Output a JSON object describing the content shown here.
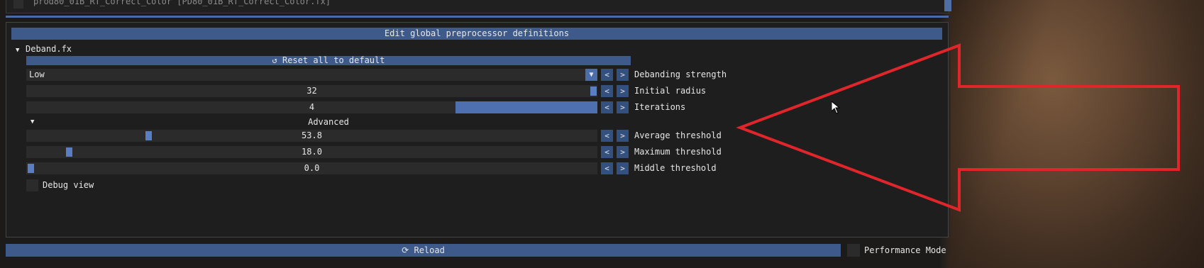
{
  "top_list": {
    "item_text": "prod80_01B_RT_Correct_Color [PD80_01B_RT_Correct_Color.fx]"
  },
  "header_button": "Edit global preprocessor definitions",
  "tree": {
    "node_label": "Deband.fx",
    "reset_label": "Reset all to default",
    "rows": [
      {
        "value": "Low",
        "label": "Debanding strength"
      },
      {
        "value": "32",
        "label": "Initial radius",
        "fraction": 1.0
      },
      {
        "value": "4",
        "label": "Iterations",
        "fraction": 0.25
      },
      {
        "value": "53.8",
        "label": "Average threshold",
        "fraction": 0.21
      },
      {
        "value": "18.0",
        "label": "Maximum threshold",
        "fraction": 0.07
      },
      {
        "value": "0.0",
        "label": "Middle threshold",
        "fraction": 0.0
      }
    ],
    "advanced_label": "Advanced",
    "debug_label": "Debug view",
    "stepper_prev": "<",
    "stepper_next": ">"
  },
  "footer": {
    "reload_label": "Reload",
    "perf_label": "Performance Mode"
  },
  "colors": {
    "accent": "#3d5a8a",
    "annotation_red": "#e0262b"
  },
  "icons": {
    "reset": "undo-icon",
    "reload": "refresh-icon",
    "combo": "triangle-down-icon"
  }
}
